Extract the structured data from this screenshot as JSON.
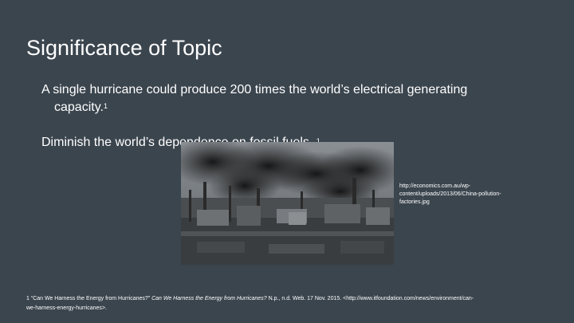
{
  "slide": {
    "title": "Significance of Topic",
    "bullet1": {
      "line1": "A single hurricane could produce 200 times the world’s electrical generating",
      "line2": "capacity.",
      "sup": "1"
    },
    "bullet2": {
      "text": "Diminish the world’s dependence on fossil fuels.",
      "sup": "1"
    },
    "photo": {
      "icon": "factory-pollution-photo"
    },
    "caption": {
      "line1": "http://economics.com.au/wp-",
      "line2": "content/uploads/2013/06/China-pollution-",
      "line3": "factories.jpg"
    },
    "footnote": {
      "mark": "1",
      "quoted": "“Can We Harness the Energy from Hurricanes?”",
      "italic": "Can We Harness the Energy from Hurricanes?",
      "rest": " N.p., n.d. Web. 17 Nov. 2015. <http://www.itfoundation.com/news/environment/can-",
      "line2": "we-harness-energy-hurricanes>."
    }
  }
}
